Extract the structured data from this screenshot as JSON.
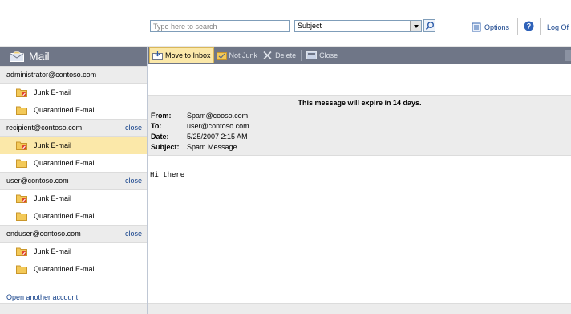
{
  "search": {
    "placeholder": "Type here to search",
    "scope_value": "Subject"
  },
  "topnav": {
    "options_label": "Options",
    "logoff_label": "Log Of"
  },
  "mail": {
    "title": "Mail"
  },
  "accounts": [
    {
      "email": "administrator@contoso.com",
      "close_label": "",
      "folders": [
        {
          "label": "Junk E-mail"
        },
        {
          "label": "Quarantined E-mail"
        }
      ]
    },
    {
      "email": "recipient@contoso.com",
      "close_label": "close",
      "folders": [
        {
          "label": "Junk E-mail"
        },
        {
          "label": "Quarantined E-mail"
        }
      ]
    },
    {
      "email": "user@contoso.com",
      "close_label": "close",
      "folders": [
        {
          "label": "Junk E-mail"
        },
        {
          "label": "Quarantined E-mail"
        }
      ]
    },
    {
      "email": "enduser@contoso.com",
      "close_label": "close",
      "folders": [
        {
          "label": "Junk E-mail"
        },
        {
          "label": "Quarantined E-mail"
        }
      ]
    }
  ],
  "open_another_label": "Open another account",
  "toolbar": {
    "move_to_inbox": "Move to Inbox",
    "not_junk": "Not Junk",
    "delete": "Delete",
    "close": "Close"
  },
  "message": {
    "expiry_notice": "This message will expire in 14 days.",
    "from_label": "From:",
    "from": "Spam@cooso.com",
    "to_label": "To:",
    "to": "user@contoso.com",
    "date_label": "Date:",
    "date": "5/25/2007 2:15 AM",
    "subject_label": "Subject:",
    "subject": "Spam Message",
    "body": "Hi there"
  },
  "colors": {
    "header_gray": "#6f7687",
    "selected": "#fbe8a9",
    "link": "#15428b",
    "panel_gray": "#ececec"
  }
}
